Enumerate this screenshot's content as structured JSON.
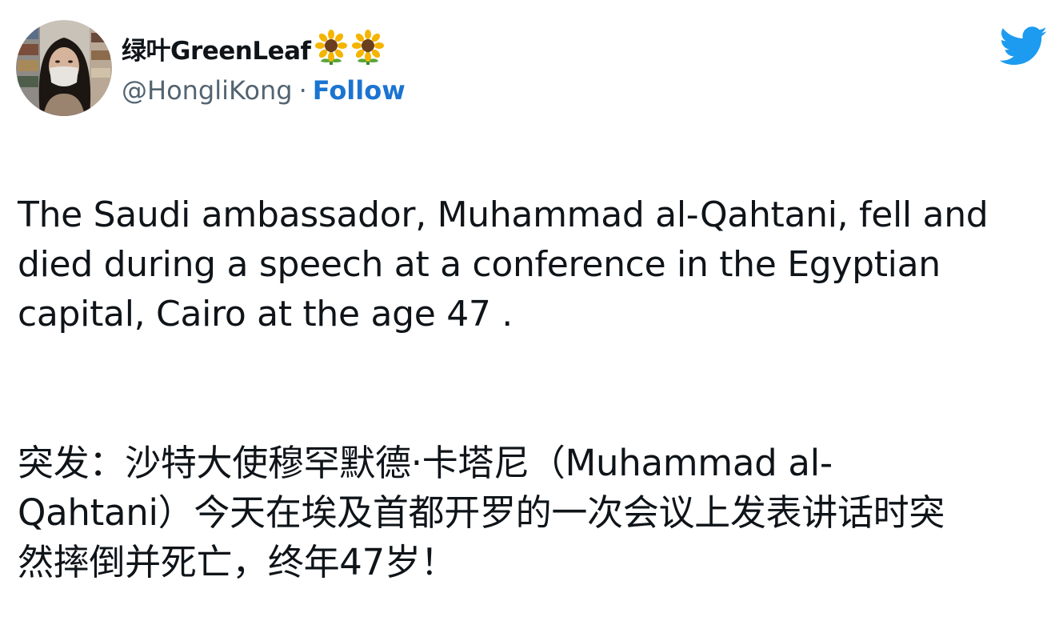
{
  "tweet": {
    "author": {
      "display_name": "绿叶GreenLeaf",
      "emoji": [
        "sunflower",
        "sunflower"
      ],
      "handle": "@HongliKong",
      "separator": "·",
      "follow_label": "Follow",
      "avatar_icon": "avatar-photo"
    },
    "brand_icon": "twitter-bird-icon",
    "brand_color": "#1d9bf0",
    "link_color": "#1b74d1",
    "text_en": "The Saudi ambassador, Muhammad al-Qahtani, fell and\ndied during a speech at a conference in the Egyptian\ncapital, Cairo at the age 47 .",
    "text_zh": "突发：沙特大使穆罕默德·卡塔尼（Muhammad al-\nQahtani）今天在埃及首都开罗的一次会议上发表讲话时突\n然摔倒并死亡，终年47岁！"
  }
}
